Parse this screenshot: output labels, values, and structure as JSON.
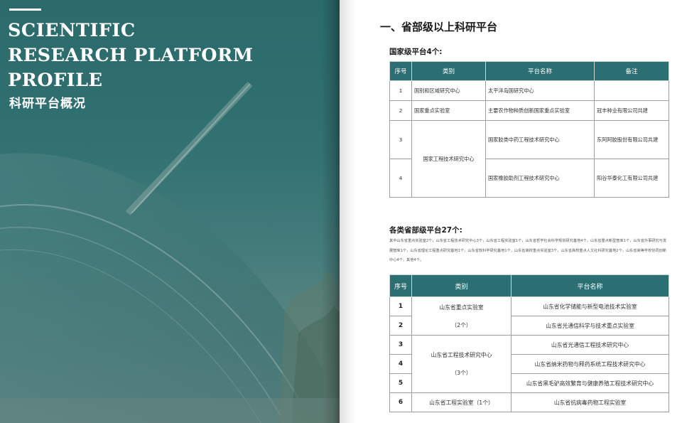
{
  "cover": {
    "title_lines": [
      "SCIENTIFIC",
      "RESEARCH PLATFORM",
      "PROFILE"
    ],
    "subtitle": "科研平台概况"
  },
  "section_title": "一、省部级以上科研平台",
  "national": {
    "heading": "国家级平台4个:",
    "headers": [
      "序号",
      "类别",
      "平台名称",
      "备注"
    ],
    "rows": [
      {
        "no": "1",
        "category": "国别和区域研究中心",
        "name": "太平洋岛国研究中心",
        "note": ""
      },
      {
        "no": "2",
        "category": "国家重点实验室",
        "name": "主要农作物种质创新国家重点实验室",
        "note": "冠丰种业有限公司共建"
      },
      {
        "no": "3",
        "category": "国家工程技术研究中心",
        "name": "国家胶类中药工程技术研究中心",
        "note": "东阿阿胶股份有限公司共建"
      },
      {
        "no": "4",
        "category": "",
        "name": "国家橡胶助剂工程技术研究中心",
        "note": "阳谷华泰化工有限公司共建"
      }
    ]
  },
  "provincial": {
    "heading": "各类省部级平台27个:",
    "description": "其中山东省重点实验室2个，山东省工程技术研究中心3个，山东省工程实验室1个，山东省哲学社会科学规划研究基地4个，山东省重点新型智库1个，山东省外事研究与发展智库1个，山东省理论工程重点研究基地1个，山东省软科学研究基地1个，山东省高校重点实验室3个，山东省高校重点人文社科研究基地2个，山东省高等学校协同创新中心4个，其他4个。",
    "headers": [
      "序号",
      "类别",
      "平台名称"
    ],
    "rows": [
      {
        "no": "1",
        "category": "山东省重点实验室",
        "count": "（2个）",
        "name": "山东省化学储能与新型电池技术实验室"
      },
      {
        "no": "2",
        "category": "",
        "count": "",
        "name": "山东省光通信科学与技术重点实验室"
      },
      {
        "no": "3",
        "category": "山东省工程技术研究中心",
        "count": "（3个）",
        "name": "山东省光通信工程技术研究中心"
      },
      {
        "no": "4",
        "category": "",
        "count": "",
        "name": "山东省纳米药物与释药系统工程技术研究中心"
      },
      {
        "no": "5",
        "category": "",
        "count": "",
        "name": "山东省黑毛驴高效繁育与健康养殖工程技术研究中心"
      },
      {
        "no": "6",
        "category": "山东省工程实验室（1个）",
        "count": "",
        "name": "山东省抗病毒药物工程实验室"
      }
    ]
  }
}
